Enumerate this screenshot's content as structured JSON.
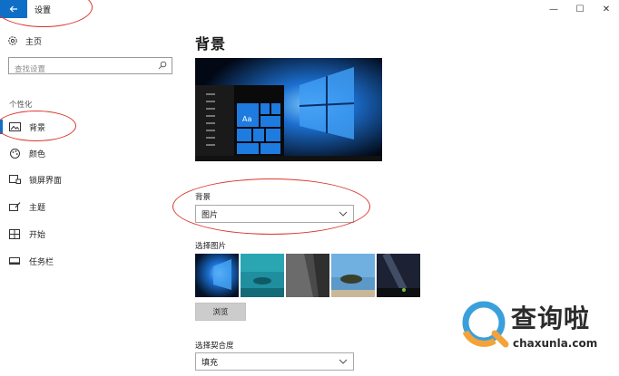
{
  "titlebar": {
    "title": "设置",
    "back_icon": "arrow-left-icon",
    "minimize_glyph": "—",
    "maximize_glyph": "☐",
    "close_glyph": "✕",
    "accent": "#0f6fc6"
  },
  "sidebar": {
    "home_label": "主页",
    "search_placeholder": "查找设置",
    "section_label": "个性化",
    "items": [
      {
        "label": "背景",
        "icon": "picture-icon",
        "active": true
      },
      {
        "label": "颜色",
        "icon": "palette-icon",
        "active": false
      },
      {
        "label": "锁屏界面",
        "icon": "lock-screen-icon",
        "active": false
      },
      {
        "label": "主题",
        "icon": "theme-brush-icon",
        "active": false
      },
      {
        "label": "开始",
        "icon": "start-grid-icon",
        "active": false
      },
      {
        "label": "任务栏",
        "icon": "taskbar-icon",
        "active": false
      }
    ]
  },
  "main": {
    "page_title": "背景",
    "preview_tile_label": "Aa",
    "background_label": "背景",
    "background_value": "图片",
    "choose_picture_label": "选择图片",
    "browse_label": "浏览",
    "fit_label": "选择契合度",
    "fit_value": "填充"
  },
  "watermark": {
    "text": "查询啦",
    "url": "chaxunla.com"
  }
}
